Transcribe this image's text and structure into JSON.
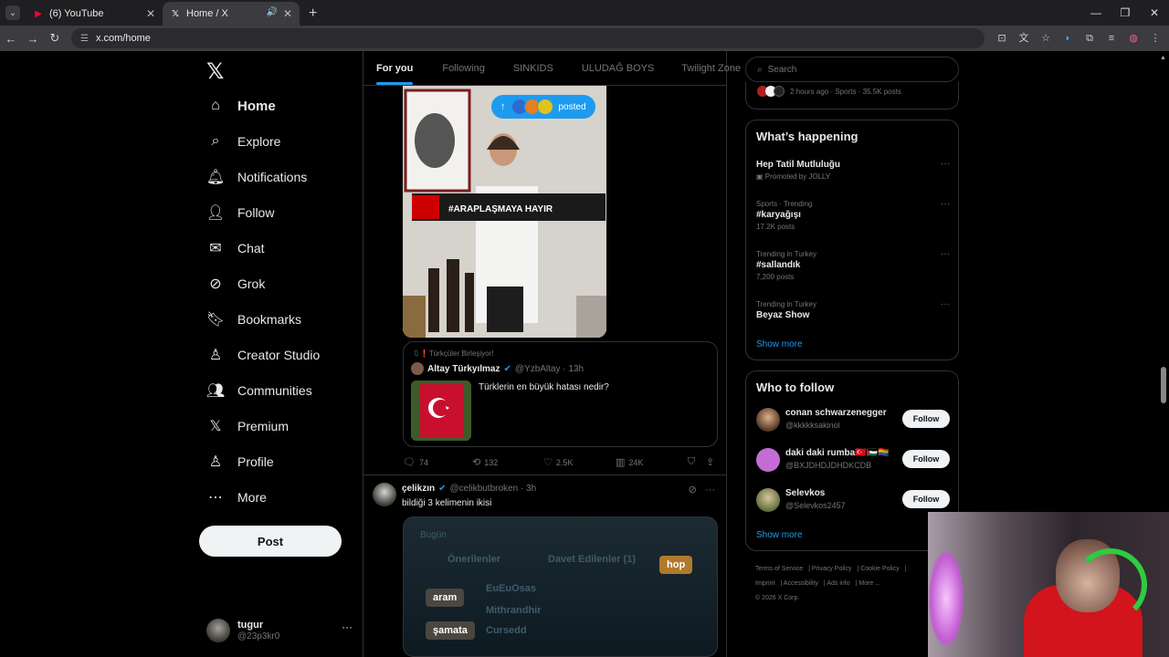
{
  "browser": {
    "tabs": [
      {
        "title": "(6) YouTube",
        "active": false
      },
      {
        "title": "Home / X",
        "active": true
      }
    ],
    "url": "x.com/home"
  },
  "nav": {
    "items": [
      {
        "label": "Home",
        "icon": "home-icon"
      },
      {
        "label": "Explore",
        "icon": "search-icon"
      },
      {
        "label": "Notifications",
        "icon": "bell-icon"
      },
      {
        "label": "Follow",
        "icon": "person-add-icon"
      },
      {
        "label": "Chat",
        "icon": "mail-icon"
      },
      {
        "label": "Grok",
        "icon": "grok-icon"
      },
      {
        "label": "Bookmarks",
        "icon": "bookmark-icon"
      },
      {
        "label": "Creator Studio",
        "icon": "creator-icon"
      },
      {
        "label": "Communities",
        "icon": "communities-icon"
      },
      {
        "label": "Premium",
        "icon": "x-icon"
      },
      {
        "label": "Profile",
        "icon": "person-icon"
      },
      {
        "label": "More",
        "icon": "more-circle-icon"
      }
    ],
    "post_label": "Post",
    "account": {
      "name": "tugur",
      "handle": "@23p3kr0"
    }
  },
  "feed": {
    "tabs": [
      "For you",
      "Following",
      "SINKIDS",
      "ULUDAĞ BOYS",
      "Twilight Zone"
    ],
    "posted_pill": "posted",
    "quote": {
      "context": "Türkçüler Birleşiyor!",
      "author": "Altay Türkyılmaz",
      "handle_time": "@YzbAltay · 13h",
      "text": "Türklerin en büyük hatası nedir?"
    },
    "image_banner": "#ARAPLAŞMAYA HAYIR",
    "actions": {
      "replies": "74",
      "reposts": "132",
      "likes": "2.5K",
      "views": "24K"
    },
    "tweet2": {
      "author": "çelikzın",
      "handle_time": "@celikbutbroken · 3h",
      "text": "bildiği 3 kelimenin ikisi",
      "image_labels": [
        "Bugün",
        "Önerilenler",
        "Davet Edilenler (1)",
        "hop",
        "aram",
        "EuEuOsas",
        "Mithrandhir",
        "şamata",
        "Cursedd"
      ]
    }
  },
  "sidebar": {
    "search_placeholder": "Search",
    "top_meta": "2 hours ago · Sports · 35.5K posts",
    "happening": {
      "title": "What’s happening",
      "trends": [
        {
          "context": "",
          "title": "Hep Tatil Mutluluğu",
          "posts": "Promoted by JOLLY"
        },
        {
          "context": "Sports · Trending",
          "title": "#karyağışı",
          "posts": "17.2K posts"
        },
        {
          "context": "Trending in Turkey",
          "title": "#sallandık",
          "posts": "7,200 posts"
        },
        {
          "context": "Trending in Turkey",
          "title": "Beyaz Show",
          "posts": ""
        }
      ],
      "show_more": "Show more"
    },
    "who_to_follow": {
      "title": "Who to follow",
      "users": [
        {
          "name": "conan schwarzenegger",
          "handle": "@kkkkksakinol"
        },
        {
          "name": "daki daki rumba🇹🇷🇵🇸🏳️‍🌈",
          "handle": "@BXJDHDJDHDKCDB"
        },
        {
          "name": "Selevkos",
          "handle": "@Selevkos2457"
        }
      ],
      "follow_label": "Follow",
      "show_more": "Show more"
    },
    "footer": [
      "Terms of Service",
      "Privacy Policy",
      "Cookie Policy",
      "Imprint",
      "Accessibility",
      "Ads info",
      "More ...",
      "© 2026 X Corp."
    ]
  }
}
